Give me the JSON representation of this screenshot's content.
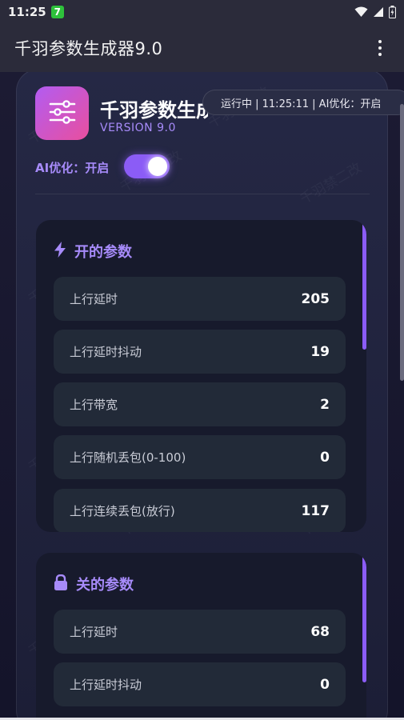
{
  "status_bar": {
    "time": "11:25",
    "badge": "7"
  },
  "app_bar": {
    "title": "千羽参数生成器9.0"
  },
  "brand": {
    "title": "千羽参数生成器",
    "version": "VERSION 9.0"
  },
  "status_pill": "运行中 | 11:25:11 | AI优化：开启",
  "ai_toggle": {
    "label": "AI优化：开启",
    "on": true
  },
  "sections": [
    {
      "title": "开的参数",
      "icon": "lightning-icon",
      "params": [
        {
          "label": "上行延时",
          "value": "205"
        },
        {
          "label": "上行延时抖动",
          "value": "19"
        },
        {
          "label": "上行带宽",
          "value": "2"
        },
        {
          "label": "上行随机丢包(0-100)",
          "value": "0"
        },
        {
          "label": "上行连续丢包(放行)",
          "value": "117"
        }
      ]
    },
    {
      "title": "关的参数",
      "icon": "lock-icon",
      "params": [
        {
          "label": "上行延时",
          "value": "68"
        },
        {
          "label": "上行延时抖动",
          "value": "0"
        }
      ]
    }
  ],
  "watermark_text": "千羽禁二改",
  "colors": {
    "accent": "#8b5cf6",
    "accent_text": "#a78bfa",
    "logo_gradient_start": "#b25cf2",
    "logo_gradient_end": "#e94f9e",
    "status_badge": "#2ec13b"
  }
}
